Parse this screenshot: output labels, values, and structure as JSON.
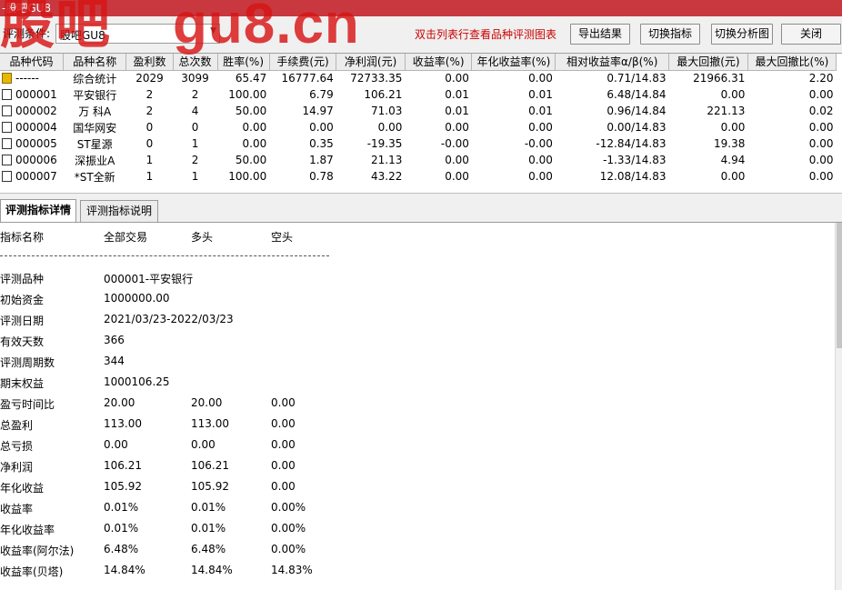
{
  "window": {
    "title": "-股吧GU8",
    "watermark_left": "股吧",
    "watermark_right": "gu8.cn"
  },
  "toolbar": {
    "condition_label": "评测条件:",
    "condition_value": "股吧GU8",
    "hint": "双击列表行查看品种评测图表",
    "export_button": "导出结果",
    "switch_indicator_button": "切换指标",
    "switch_chart_button": "切换分析图",
    "close_button": "关闭"
  },
  "table": {
    "columns": [
      "品种代码",
      "品种名称",
      "盈利数",
      "总次数",
      "胜率(%)",
      "手续费(元)",
      "净利润(元)",
      "收益率(%)",
      "年化收益率(%)",
      "相对收益率α/β(%)",
      "最大回撤(元)",
      "最大回撤比(%)"
    ],
    "rows": [
      {
        "code": "------",
        "name": "综合统计",
        "wins": "2029",
        "total": "3099",
        "rate": "65.47",
        "fee": "16777.64",
        "profit": "72733.35",
        "ret": "0.00",
        "annual": "0.00",
        "relative": "0.71/14.83",
        "dd": "21966.31",
        "ddr": "2.20",
        "icon": "summary"
      },
      {
        "code": "000001",
        "name": "平安银行",
        "wins": "2",
        "total": "2",
        "rate": "100.00",
        "fee": "6.79",
        "profit": "106.21",
        "ret": "0.01",
        "annual": "0.01",
        "relative": "6.48/14.84",
        "dd": "0.00",
        "ddr": "0.00",
        "icon": "stock"
      },
      {
        "code": "000002",
        "name": "万 科A",
        "wins": "2",
        "total": "4",
        "rate": "50.00",
        "fee": "14.97",
        "profit": "71.03",
        "ret": "0.01",
        "annual": "0.01",
        "relative": "0.96/14.84",
        "dd": "221.13",
        "ddr": "0.02",
        "icon": "stock"
      },
      {
        "code": "000004",
        "name": "国华网安",
        "wins": "0",
        "total": "0",
        "rate": "0.00",
        "fee": "0.00",
        "profit": "0.00",
        "ret": "0.00",
        "annual": "0.00",
        "relative": "0.00/14.83",
        "dd": "0.00",
        "ddr": "0.00",
        "icon": "stock"
      },
      {
        "code": "000005",
        "name": "ST星源",
        "wins": "0",
        "total": "1",
        "rate": "0.00",
        "fee": "0.35",
        "profit": "-19.35",
        "ret": "-0.00",
        "annual": "-0.00",
        "relative": "-12.84/14.83",
        "dd": "19.38",
        "ddr": "0.00",
        "icon": "stock"
      },
      {
        "code": "000006",
        "name": "深振业A",
        "wins": "1",
        "total": "2",
        "rate": "50.00",
        "fee": "1.87",
        "profit": "21.13",
        "ret": "0.00",
        "annual": "0.00",
        "relative": "-1.33/14.83",
        "dd": "4.94",
        "ddr": "0.00",
        "icon": "stock"
      },
      {
        "code": "000007",
        "name": "*ST全新",
        "wins": "1",
        "total": "1",
        "rate": "100.00",
        "fee": "0.78",
        "profit": "43.22",
        "ret": "0.00",
        "annual": "0.00",
        "relative": "12.08/14.83",
        "dd": "0.00",
        "ddr": "0.00",
        "icon": "stock"
      }
    ]
  },
  "tabs": [
    {
      "label": "评测指标详情",
      "active": true
    },
    {
      "label": "评测指标说明",
      "active": false
    }
  ],
  "detail": {
    "headers": {
      "name": "指标名称",
      "all": "全部交易",
      "long": "多头",
      "short": "空头"
    },
    "rows": [
      {
        "label": "评测品种",
        "v1": "000001-平安银行",
        "v2": "",
        "v3": ""
      },
      {
        "label": "初始资金",
        "v1": "1000000.00",
        "v2": "",
        "v3": ""
      },
      {
        "label": "评测日期",
        "v1": "2021/03/23-2022/03/23",
        "v2": "",
        "v3": ""
      },
      {
        "label": "有效天数",
        "v1": "366",
        "v2": "",
        "v3": ""
      },
      {
        "label": "评测周期数",
        "v1": " 344",
        "v2": "",
        "v3": ""
      },
      {
        "label": "期末权益",
        "v1": "1000106.25",
        "v2": "",
        "v3": ""
      },
      {
        "label": "盈亏时间比",
        "v1": " 20.00",
        "v2": "20.00",
        "v3": "0.00"
      },
      {
        "label": "总盈利",
        "v1": "113.00",
        "v2": "113.00",
        "v3": "0.00"
      },
      {
        "label": "总亏损",
        "v1": "0.00",
        "v2": "0.00",
        "v3": "0.00"
      },
      {
        "label": "净利润",
        "v1": "106.21",
        "v2": "106.21",
        "v3": "0.00"
      },
      {
        "label": "年化收益",
        "v1": "105.92",
        "v2": "105.92",
        "v3": "0.00"
      },
      {
        "label": "收益率",
        "v1": "0.01%",
        "v2": "0.01%",
        "v3": "0.00%"
      },
      {
        "label": "年化收益率",
        "v1": " 0.01%",
        "v2": "0.01%",
        "v3": "0.00%"
      },
      {
        "label": "收益率(阿尔法)",
        "v1": "6.48%",
        "v2": "6.48%",
        "v3": "0.00%"
      },
      {
        "label": "收益率(贝塔)",
        "v1": "14.84%",
        "v2": "14.84%",
        "v3": "14.83%"
      }
    ]
  },
  "colors": {
    "titlebar": "#c8383e",
    "hint": "#cc0000",
    "watermark": "#d71414"
  }
}
